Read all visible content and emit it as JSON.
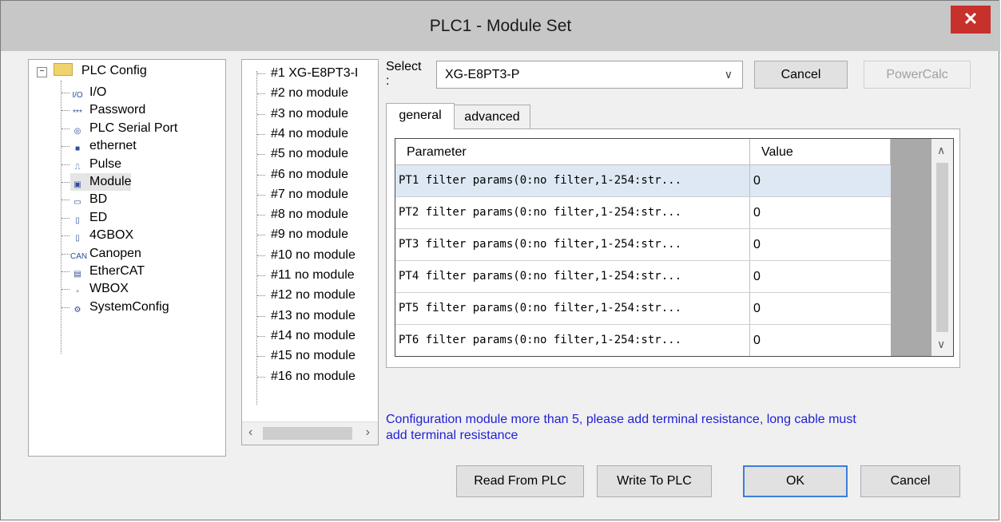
{
  "window": {
    "title": "PLC1 - Module  Set",
    "close_glyph": "✕"
  },
  "tree": {
    "root_label": "PLC Config",
    "items": [
      {
        "label": "I/O",
        "icon": "io-icon",
        "glyph": "I/O"
      },
      {
        "label": "Password",
        "icon": "password-icon",
        "glyph": "***"
      },
      {
        "label": "PLC Serial Port",
        "icon": "serial-port-icon",
        "glyph": "◎"
      },
      {
        "label": "ethernet",
        "icon": "ethernet-icon",
        "glyph": "■"
      },
      {
        "label": "Pulse",
        "icon": "pulse-icon",
        "glyph": "⎍"
      },
      {
        "label": "Module",
        "icon": "module-icon",
        "glyph": "▣"
      },
      {
        "label": "BD",
        "icon": "bd-icon",
        "glyph": "▭"
      },
      {
        "label": "ED",
        "icon": "ed-icon",
        "glyph": "▯"
      },
      {
        "label": "4GBOX",
        "icon": "4gbox-icon",
        "glyph": "▯"
      },
      {
        "label": "Canopen",
        "icon": "canopen-icon",
        "glyph": "CAN"
      },
      {
        "label": "EtherCAT",
        "icon": "ethercat-icon",
        "glyph": "▤"
      },
      {
        "label": "WBOX",
        "icon": "wbox-icon",
        "glyph": "▫"
      },
      {
        "label": "SystemConfig",
        "icon": "system-config-icon",
        "glyph": "⚙"
      }
    ],
    "selected": "Module"
  },
  "modules": [
    "#1 XG-E8PT3-I",
    "#2 no module",
    "#3 no module",
    "#4 no module",
    "#5 no module",
    "#6 no module",
    "#7 no module",
    "#8 no module",
    "#9 no module",
    "#10 no module",
    "#11 no module",
    "#12 no module",
    "#13 no module",
    "#14 no module",
    "#15 no module",
    "#16 no module"
  ],
  "select": {
    "label": "Select\n:",
    "value": "XG-E8PT3-P"
  },
  "buttons": {
    "cancel_top": "Cancel",
    "powercalc": "PowerCalc",
    "read_from_plc": "Read From PLC",
    "write_to_plc": "Write To PLC",
    "ok": "OK",
    "cancel_bottom": "Cancel"
  },
  "tabs": {
    "general": "general",
    "advanced": "advanced"
  },
  "grid": {
    "headers": [
      "Parameter",
      "Value"
    ],
    "rows": [
      [
        "PT1 filter params(0:no filter,1-254:str...",
        "0"
      ],
      [
        "PT2 filter params(0:no filter,1-254:str...",
        "0"
      ],
      [
        "PT3 filter params(0:no filter,1-254:str...",
        "0"
      ],
      [
        "PT4 filter params(0:no filter,1-254:str...",
        "0"
      ],
      [
        "PT5 filter params(0:no filter,1-254:str...",
        "0"
      ],
      [
        "PT6 filter params(0:no filter,1-254:str...",
        "0"
      ]
    ]
  },
  "note": "Configuration module more than 5, please add terminal resistance, long cable must add terminal resistance",
  "colors": {
    "note": "#1f1fd6",
    "close": "#c8302c",
    "selected_row": "#dde8f4"
  }
}
